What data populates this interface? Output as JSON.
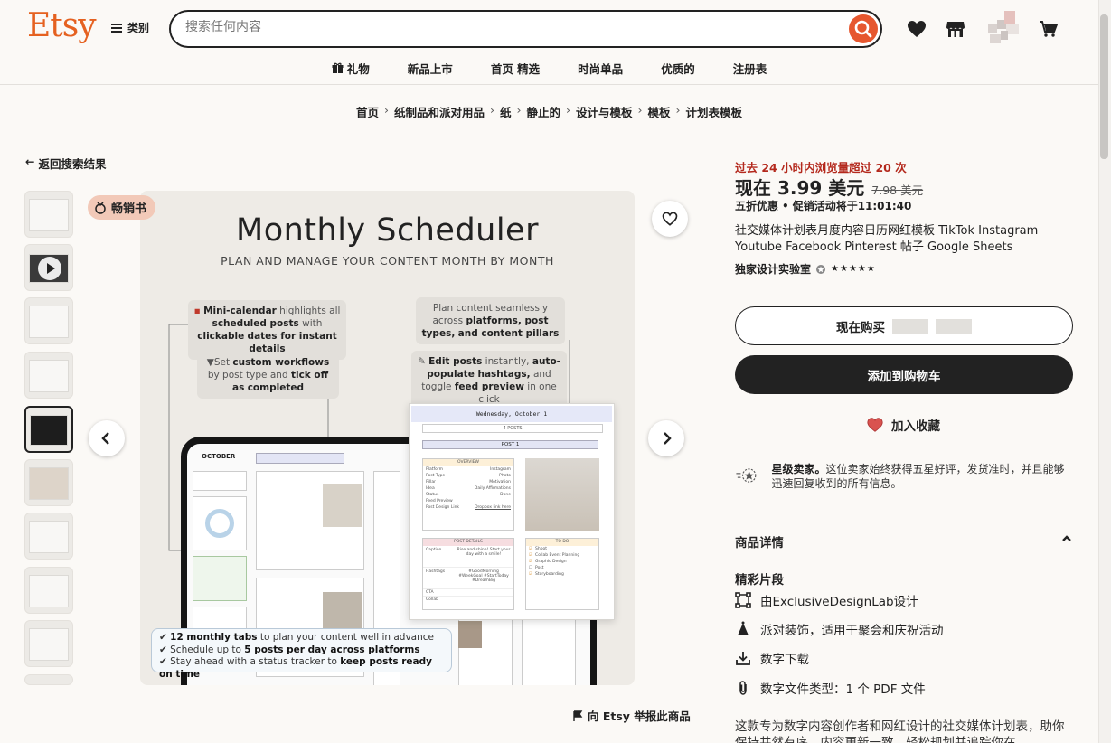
{
  "header": {
    "logo": "Etsy",
    "menu_label": "类别",
    "search_placeholder": "搜索任何内容",
    "icons": [
      "search-icon",
      "heart-icon",
      "shop-icon",
      "avatar",
      "cart-icon"
    ],
    "brand_color": "#e56120"
  },
  "topnav": [
    "礼物",
    "新品上市",
    "首页 精选",
    "时尚单品",
    "优质的",
    "注册表"
  ],
  "breadcrumb": [
    "首页",
    "纸制品和派对用品",
    "纸",
    "静止的",
    "设计与模板",
    "模板",
    "计划表模板"
  ],
  "back_link": "返回搜索结果",
  "gallery": {
    "badge": "畅销书",
    "image": {
      "title": "Monthly Scheduler",
      "subtitle": "PLAN AND MANAGE YOUR CONTENT MONTH BY MONTH",
      "callout1": [
        "Mini-calendar",
        " highlights all ",
        "scheduled posts",
        " with ",
        "clickable",
        " ",
        "dates for instant details"
      ],
      "callout2": [
        "Set ",
        "custom workflows",
        " by post type and ",
        "tick off as",
        " ",
        "completed"
      ],
      "callout3": [
        "Plan content seamlessly across ",
        "platforms, post types,",
        " ",
        "and content pillars"
      ],
      "callout4": [
        "Edit posts",
        " instantly, ",
        "auto-populate hashtags,",
        " and toggle ",
        "feed preview",
        " in one click"
      ],
      "bottom_lines": [
        [
          "12 monthly tabs",
          " to plan your content well in advance"
        ],
        [
          "Schedule up to ",
          "5 posts per day across platforms"
        ],
        [
          "Stay ahead with a status tracker to ",
          "keep posts ready on time"
        ]
      ],
      "screen_heading": "OCTOBER",
      "card_heading": "Wednesday, October 1",
      "card_sub": "4 POSTS",
      "card_post": "POST 1",
      "card_overview": "OVERVIEW",
      "card_rows": [
        [
          "Platform",
          "Instagram"
        ],
        [
          "Post Type",
          "Photo"
        ],
        [
          "Pillar",
          "Motivation"
        ],
        [
          "Idea",
          "Daily Affirmations"
        ],
        [
          "Status",
          "Done"
        ],
        [
          "Feed Preview",
          ""
        ],
        [
          "Post Design Link",
          "Dropbox link here"
        ]
      ],
      "card_post_details": "POST DETAILS",
      "card_to_do": "TO DO",
      "card_todo_items": [
        "Shoot",
        "Collab Event Planning",
        "Graphic Design",
        "Post",
        "Storyboarding"
      ],
      "card_details_rows": [
        "Caption",
        "Hashtags",
        "CTA",
        "Collab"
      ],
      "card_caption": "Rise and shine! Start your day with a smile!",
      "card_hashtags": "#GoodMorning #WeekGoal #StartToday #DreamBig"
    }
  },
  "report_label": "向 Etsy 举报此商品",
  "product": {
    "views": "过去 24 小时内浏览量超过 20 次",
    "price": "现在 3.99 美元",
    "old_price": "7.98 美元",
    "discount": "五折优惠",
    "sale_ends": "促销活动将于11:01:40",
    "title": "社交媒体计划表月度内容日历网红模板 TikTok Instagram Youtube Facebook Pinterest 帖子 Google Sheets",
    "seller": "独家设计实验室",
    "rating": "★★★★★",
    "buy_now": "现在购买",
    "add_to_cart": "添加到购物车",
    "add_favorite": "加入收藏",
    "star_seller_title": "星级卖家。",
    "star_seller_text": "这位卖家始终获得五星好评，发货准时，并且能够迅速回复收到的所有信息。",
    "details_heading": "商品详情",
    "highlights_heading": "精彩片段",
    "highlights": [
      "由ExclusiveDesignLab设计",
      "派对装饰，适用于聚会和庆祝活动",
      "数字下载",
      "数字文件类型：1 个 PDF 文件"
    ],
    "description": "这款专为数字内容创作者和网红设计的社交媒体计划表，助你保持井然有序，内容更新一致，轻松规划并追踪你在"
  }
}
